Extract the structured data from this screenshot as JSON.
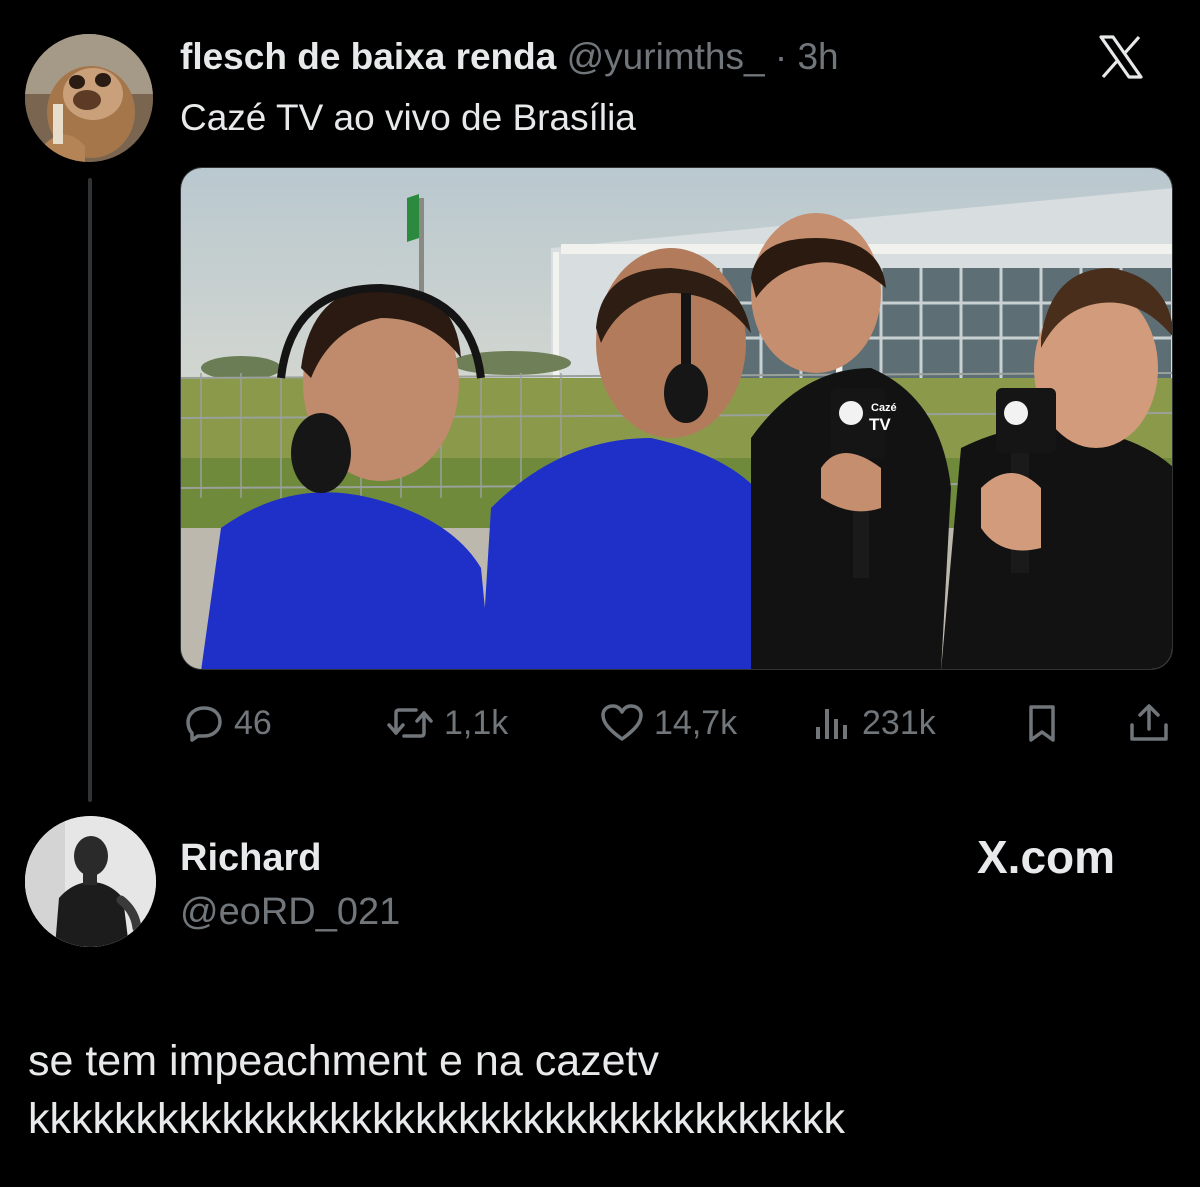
{
  "original_tweet": {
    "display_name": "flesch de baixa renda",
    "handle": "@yurimths_",
    "separator": "·",
    "time": "3h",
    "text": "Cazé TV ao vivo de Brasília",
    "avatar_icon": "alf-avatar",
    "media": {
      "microphone_label_top": "Cazé",
      "microphone_label_bottom": "TV"
    },
    "stats": {
      "replies": "46",
      "retweets": "1,1k",
      "likes": "14,7k",
      "views": "231k"
    }
  },
  "reply": {
    "display_name": "Richard",
    "handle": "@eoRD_021",
    "brand": "X.com",
    "line1": "se tem impeachment e na cazetv",
    "line2": "kkkkkkkkkkkkkkkkkkkkkkkkkkkkkkkkkkkkkk"
  },
  "colors": {
    "background": "#000000",
    "text": "#e7e9ea",
    "muted": "#71767b",
    "shirt_blue": "#1e2ec4"
  },
  "icons": [
    "reply-icon",
    "retweet-icon",
    "like-icon",
    "views-icon",
    "bookmark-icon",
    "share-icon",
    "x-logo-icon"
  ]
}
